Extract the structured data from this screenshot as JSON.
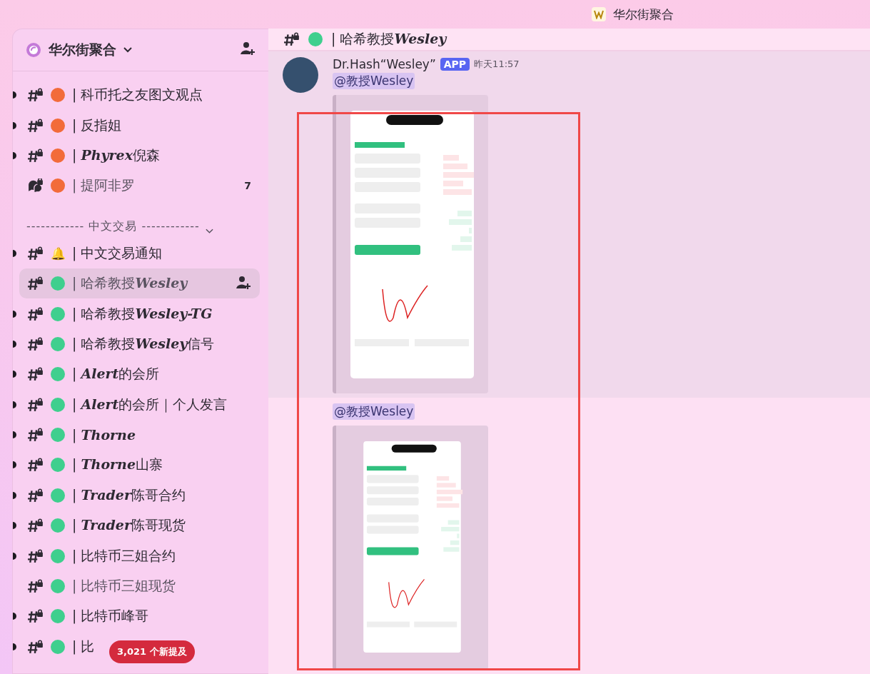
{
  "window": {
    "title": "华尔街聚合"
  },
  "server": {
    "name": "华尔街聚合"
  },
  "channels": [
    {
      "kind": "text",
      "name": "| 科币托之友图文观点",
      "color": "#f26b3a",
      "unread": true,
      "selected": false
    },
    {
      "kind": "text",
      "name": "| 反指姐",
      "color": "#f26b3a",
      "unread": true,
      "selected": false
    },
    {
      "kind": "text",
      "name": "| **Phyrex**倪森",
      "color": "#f26b3a",
      "unread": true,
      "selected": false
    },
    {
      "kind": "forum",
      "name": "| 提阿非罗",
      "color": "#f26b3a",
      "unread": false,
      "selected": false,
      "count": "7"
    },
    {
      "kind": "category",
      "name": "------------ 中文交易 ------------"
    },
    {
      "kind": "text",
      "emoji": "🔔",
      "name": "| 中文交易通知",
      "unread": true,
      "selected": false
    },
    {
      "kind": "text",
      "name": "| 哈希教授**Wesley**",
      "color": "#3fcf8e",
      "unread": false,
      "selected": true
    },
    {
      "kind": "text",
      "name": "| 哈希教授**Wesley-TG**",
      "color": "#3fcf8e",
      "unread": true,
      "selected": false
    },
    {
      "kind": "text",
      "name": "| 哈希教授**Wesley**信号",
      "color": "#3fcf8e",
      "unread": true,
      "selected": false
    },
    {
      "kind": "text",
      "name": "| **Alert**的会所",
      "color": "#3fcf8e",
      "unread": true,
      "selected": false
    },
    {
      "kind": "text",
      "name": "| **Alert**的会所｜个人发言",
      "color": "#3fcf8e",
      "unread": true,
      "selected": false
    },
    {
      "kind": "text",
      "name": "| **Thorne**",
      "color": "#3fcf8e",
      "unread": true,
      "selected": false
    },
    {
      "kind": "text",
      "name": "| **Thorne**山寨",
      "color": "#3fcf8e",
      "unread": true,
      "selected": false
    },
    {
      "kind": "text",
      "name": "| **Trader**陈哥合约",
      "color": "#3fcf8e",
      "unread": true,
      "selected": false
    },
    {
      "kind": "text",
      "name": "| **Trader**陈哥现货",
      "color": "#3fcf8e",
      "unread": true,
      "selected": false
    },
    {
      "kind": "text",
      "name": "| 比特币三姐合约",
      "color": "#3fcf8e",
      "unread": true,
      "selected": false
    },
    {
      "kind": "text",
      "name": "| 比特币三姐现货",
      "color": "#3fcf8e",
      "unread": false,
      "selected": false
    },
    {
      "kind": "text",
      "name": "| 比特币峰哥",
      "color": "#3fcf8e",
      "unread": true,
      "selected": false
    },
    {
      "kind": "text",
      "name": "| 比",
      "color": "#3fcf8e",
      "unread": true,
      "selected": false
    }
  ],
  "mentions_pill": "3,021 个新提及",
  "channel_header": {
    "name": "| 哈希教授**Wesley**",
    "color": "#3fcf8e"
  },
  "messages": [
    {
      "author": "Dr.Hash“Wesley”",
      "badge": "APP",
      "time": "昨天11:57",
      "highlighted": true,
      "mention": "@教授Wesley"
    },
    {
      "highlighted": false,
      "mention": "@教授Wesley"
    }
  ]
}
